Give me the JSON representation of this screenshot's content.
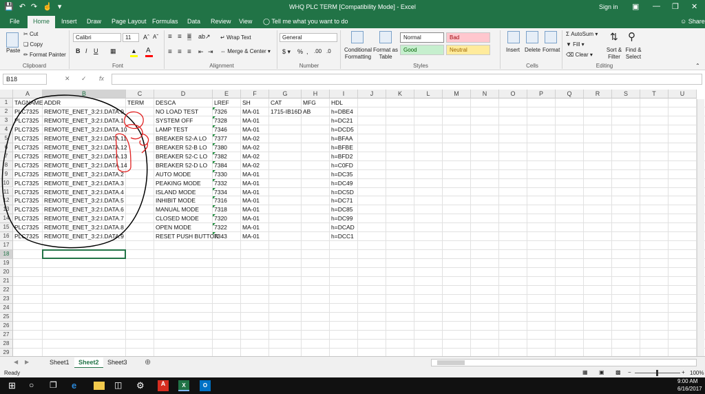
{
  "titlebar": {
    "title": "WHQ PLC TERM  [Compatibility Mode]  -  Excel",
    "signin": "Sign in"
  },
  "tabs": [
    "File",
    "Home",
    "Insert",
    "Draw",
    "Page Layout",
    "Formulas",
    "Data",
    "Review",
    "View"
  ],
  "tellme": "Tell me what you want to do",
  "share": "Share",
  "ribbon": {
    "clipboard": {
      "paste": "Paste",
      "cut": "Cut",
      "copy": "Copy",
      "format_painter": "Format Painter",
      "label": "Clipboard"
    },
    "font": {
      "name": "Calibri",
      "size": "11",
      "label": "Font"
    },
    "alignment": {
      "wrap": "Wrap Text",
      "merge": "Merge & Center",
      "label": "Alignment"
    },
    "number": {
      "format": "General",
      "label": "Number"
    },
    "styles": {
      "conditional": "Conditional Formatting",
      "format_table": "Format as Table",
      "normal": "Normal",
      "bad": "Bad",
      "good": "Good",
      "neutral": "Neutral",
      "label": "Styles"
    },
    "cells": {
      "insert": "Insert",
      "delete": "Delete",
      "format": "Format",
      "label": "Cells"
    },
    "editing": {
      "autosum": "AutoSum",
      "fill": "Fill",
      "clear": "Clear",
      "sort": "Sort & Filter",
      "find": "Find & Select",
      "label": "Editing"
    }
  },
  "formula_bar": {
    "name_box": "B18",
    "fx": "fx",
    "content": ""
  },
  "columns": [
    "A",
    "B",
    "C",
    "D",
    "E",
    "F",
    "G",
    "H",
    "I",
    "J",
    "K",
    "L",
    "M",
    "N",
    "O",
    "P",
    "Q",
    "R",
    "S",
    "T",
    "U"
  ],
  "rows": [
    "1",
    "2",
    "3",
    "4",
    "5",
    "6",
    "7",
    "8",
    "9",
    "10",
    "11",
    "12",
    "13",
    "14",
    "15",
    "16",
    "17",
    "18",
    "19",
    "20",
    "21",
    "22",
    "23",
    "24",
    "25",
    "26",
    "27",
    "28",
    "29"
  ],
  "sheet": {
    "header": [
      "TAGNAME",
      "ADDR",
      "TERM",
      "DESCA",
      "LREF",
      "SH",
      "CAT",
      "MFG",
      "HDL"
    ],
    "data": [
      [
        "PLC7325",
        "REMOTE_ENET_3:2:I.DATA.0",
        "",
        "NO LOAD TEST",
        "7326",
        "MA-01",
        "1715-IB16D",
        "AB",
        "h=DBE4"
      ],
      [
        "PLC7325",
        "REMOTE_ENET_3:2:I.DATA.1",
        "",
        "SYSTEM OFF",
        "7328",
        "MA-01",
        "",
        "",
        "h=DC21"
      ],
      [
        "PLC7325",
        "REMOTE_ENET_3:2:I.DATA.10",
        "",
        "LAMP TEST",
        "7346",
        "MA-01",
        "",
        "",
        "h=DCD5"
      ],
      [
        "PLC7325",
        "REMOTE_ENET_3:2:I.DATA.11",
        "",
        "BREAKER 52-A LO",
        "7377",
        "MA-02",
        "",
        "",
        "h=BFAA"
      ],
      [
        "PLC7325",
        "REMOTE_ENET_3:2:I.DATA.12",
        "",
        "BREAKER 52-B LO",
        "7380",
        "MA-02",
        "",
        "",
        "h=BFBE"
      ],
      [
        "PLC7325",
        "REMOTE_ENET_3:2:I.DATA.13",
        "",
        "BREAKER 52-C LO",
        "7382",
        "MA-02",
        "",
        "",
        "h=BFD2"
      ],
      [
        "PLC7325",
        "REMOTE_ENET_3:2:I.DATA.14",
        "",
        "BREAKER 52-D LO",
        "7384",
        "MA-02",
        "",
        "",
        "h=C0FD"
      ],
      [
        "PLC7325",
        "REMOTE_ENET_3:2:I.DATA.2",
        "",
        "AUTO MODE",
        "7330",
        "MA-01",
        "",
        "",
        "h=DC35"
      ],
      [
        "PLC7325",
        "REMOTE_ENET_3:2:I.DATA.3",
        "",
        "PEAKING MODE",
        "7332",
        "MA-01",
        "",
        "",
        "h=DC49"
      ],
      [
        "PLC7325",
        "REMOTE_ENET_3:2:I.DATA.4",
        "",
        "ISLAND MODE",
        "7334",
        "MA-01",
        "",
        "",
        "h=DC5D"
      ],
      [
        "PLC7325",
        "REMOTE_ENET_3:2:I.DATA.5",
        "",
        "INHIBIT MODE",
        "7316",
        "MA-01",
        "",
        "",
        "h=DC71"
      ],
      [
        "PLC7325",
        "REMOTE_ENET_3:2:I.DATA.6",
        "",
        "MANUAL MODE",
        "7318",
        "MA-01",
        "",
        "",
        "h=DC85"
      ],
      [
        "PLC7325",
        "REMOTE_ENET_3:2:I.DATA.7",
        "",
        "CLOSED MODE",
        "7320",
        "MA-01",
        "",
        "",
        "h=DC99"
      ],
      [
        "PLC7325",
        "REMOTE_ENET_3:2:I.DATA.8",
        "",
        "OPEN MODE",
        "7322",
        "MA-01",
        "",
        "",
        "h=DCAD"
      ],
      [
        "PLC7325",
        "REMOTE_ENET_3:2:I.DATA.9",
        "",
        "RESET PUSH BUTTON",
        "7343",
        "MA-01",
        "",
        "",
        "h=DCC1"
      ]
    ]
  },
  "sheets": [
    "Sheet1",
    "Sheet2",
    "Sheet3"
  ],
  "active_sheet": "Sheet2",
  "status": {
    "ready": "Ready",
    "zoom": "100%"
  },
  "taskbar": {
    "time": "9:00 AM",
    "date": "6/16/2017"
  },
  "colors": {
    "excel_green": "#217346",
    "annotation_black": "#000000",
    "annotation_red": "#e02020"
  }
}
